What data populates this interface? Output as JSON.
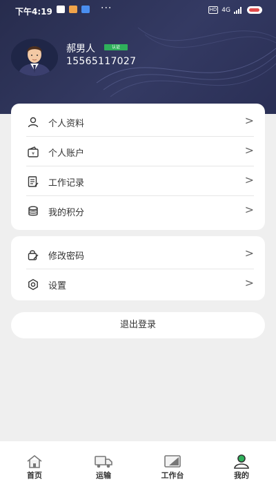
{
  "status_bar": {
    "time": "下午4:19",
    "dots": "···",
    "hd": "HD",
    "signal": "4G"
  },
  "profile": {
    "name": "郝男人",
    "badge": "认证",
    "phone": "15565117027"
  },
  "menu_group_1": [
    {
      "label": "个人资料",
      "icon": "person-icon"
    },
    {
      "label": "个人账户",
      "icon": "wallet-icon"
    },
    {
      "label": "工作记录",
      "icon": "document-icon"
    },
    {
      "label": "我的积分",
      "icon": "coins-icon"
    }
  ],
  "menu_group_2": [
    {
      "label": "修改密码",
      "icon": "edit-lock-icon"
    },
    {
      "label": "设置",
      "icon": "gear-icon"
    }
  ],
  "chevron": ">",
  "logout_label": "退出登录",
  "tabs": [
    {
      "label": "首页",
      "icon": "home-icon",
      "active": false
    },
    {
      "label": "运输",
      "icon": "truck-icon",
      "active": false
    },
    {
      "label": "工作台",
      "icon": "workbench-icon",
      "active": false
    },
    {
      "label": "我的",
      "icon": "user-icon",
      "active": true
    }
  ],
  "colors": {
    "header_bg": "#2e3458",
    "accent_green": "#2fb15b",
    "page_bg": "#efefef"
  }
}
